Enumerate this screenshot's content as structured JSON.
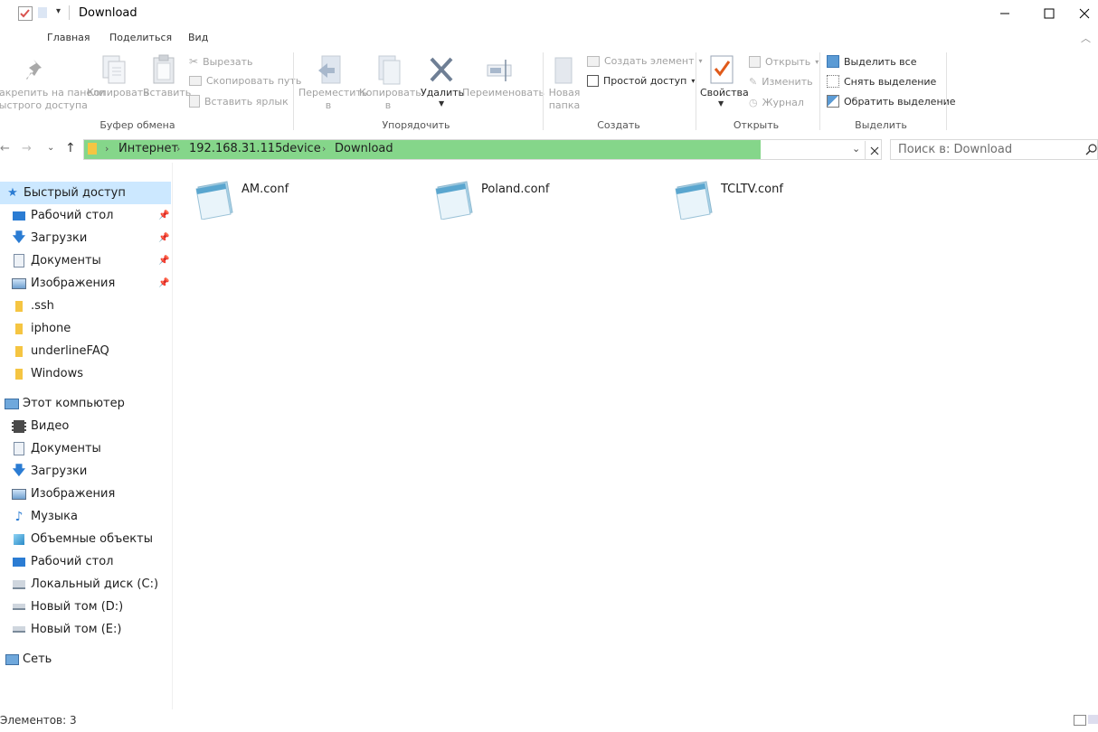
{
  "window": {
    "title": "Download"
  },
  "ribbon_tabs": [
    "Главная",
    "Поделиться",
    "Вид"
  ],
  "ribbon": {
    "pin_label_1": "Закрепить на панели",
    "pin_label_2": "быстрого доступа",
    "copy": "Копировать",
    "paste": "Вставить",
    "cut": "Вырезать",
    "copy_path": "Скопировать путь",
    "paste_shortcut": "Вставить ярлык",
    "clipboard_group": "Буфер обмена",
    "move_to_1": "Переместить",
    "move_to_2": "в",
    "copy_to_1": "Копировать",
    "copy_to_2": "в",
    "delete": "Удалить",
    "rename": "Переименовать",
    "organize_group": "Упорядочить",
    "new_folder_1": "Новая",
    "new_folder_2": "папка",
    "new_item": "Создать элемент",
    "easy_access": "Простой доступ",
    "create_group": "Создать",
    "properties": "Свойства",
    "open": "Открыть",
    "edit": "Изменить",
    "history": "Журнал",
    "open_group": "Открыть",
    "select_all": "Выделить все",
    "select_none": "Снять выделение",
    "invert_selection": "Обратить выделение",
    "select_group": "Выделить"
  },
  "address": {
    "crumbs": [
      "Интернет",
      "192.168.31.115",
      "device",
      "Download"
    ],
    "search_placeholder": "Поиск в: Download"
  },
  "nav": {
    "quick_access": "Быстрый доступ",
    "quick_items": [
      "Рабочий стол",
      "Загрузки",
      "Документы",
      "Изображения",
      ".ssh",
      "iphone",
      "underlineFAQ",
      "Windows"
    ],
    "this_pc": "Этот компьютер",
    "pc_items": [
      "Видео",
      "Документы",
      "Загрузки",
      "Изображения",
      "Музыка",
      "Объемные объекты",
      "Рабочий стол",
      "Локальный диск (C:)",
      "Новый том (D:)",
      "Новый том (E:)"
    ],
    "network": "Сеть"
  },
  "files": [
    "AM.conf",
    "Poland.conf",
    "TCLTV.conf"
  ],
  "status": {
    "items_text": "Элементов: 3"
  },
  "colors": {
    "address_highlight": "#85d68a",
    "selected_nav": "#cce8ff",
    "folder_yellow": "#f5c542",
    "blue_icon": "#2b7cd3"
  }
}
